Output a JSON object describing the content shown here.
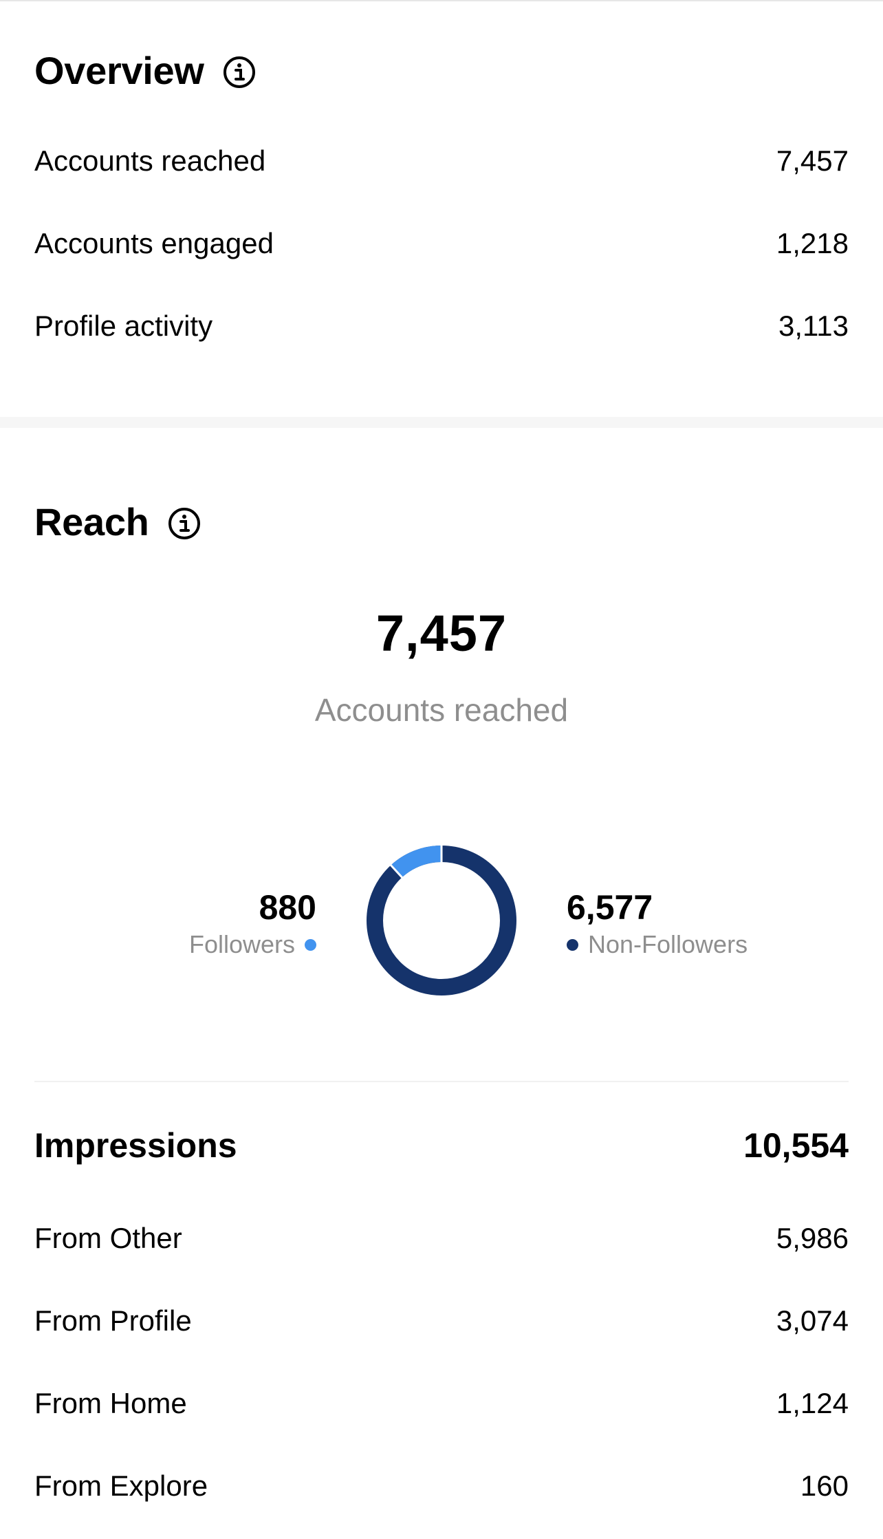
{
  "overview": {
    "title": "Overview",
    "rows": [
      {
        "label": "Accounts reached",
        "value": "7,457"
      },
      {
        "label": "Accounts engaged",
        "value": "1,218"
      },
      {
        "label": "Profile activity",
        "value": "3,113"
      }
    ]
  },
  "reach": {
    "title": "Reach",
    "total_value": "7,457",
    "total_label": "Accounts reached",
    "followers": {
      "value": "880",
      "label": "Followers",
      "color": "#4193ef",
      "count": 880
    },
    "non_followers": {
      "value": "6,577",
      "label": "Non-Followers",
      "color": "#15336b",
      "count": 6577
    }
  },
  "impressions": {
    "title": "Impressions",
    "value": "10,554",
    "rows": [
      {
        "label": "From Other",
        "value": "5,986"
      },
      {
        "label": "From Profile",
        "value": "3,074"
      },
      {
        "label": "From Home",
        "value": "1,124"
      },
      {
        "label": "From Explore",
        "value": "160"
      }
    ]
  },
  "icons": {
    "info": "info-circle-icon"
  }
}
